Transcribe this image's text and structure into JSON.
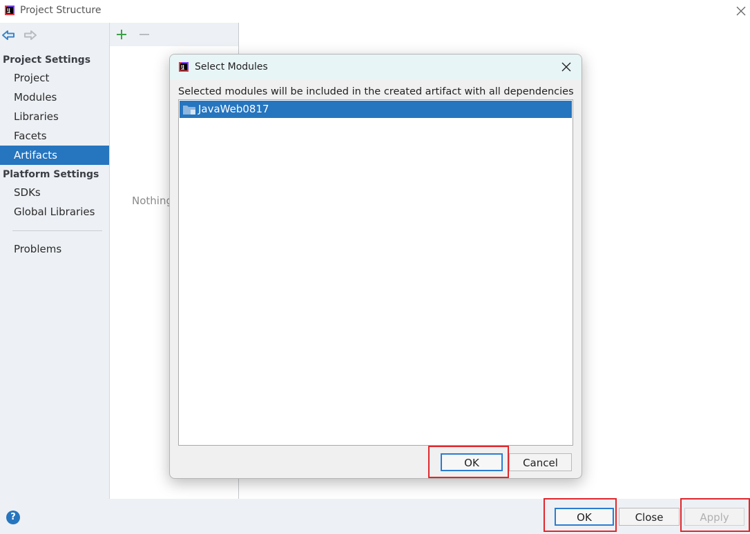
{
  "window": {
    "title": "Project Structure"
  },
  "sidebar": {
    "project_settings_header": "Project Settings",
    "platform_settings_header": "Platform Settings",
    "items": [
      "Project",
      "Modules",
      "Libraries",
      "Facets",
      "Artifacts",
      "SDKs",
      "Global Libraries",
      "Problems"
    ],
    "selected": "Artifacts"
  },
  "middle": {
    "empty_text": "Nothing"
  },
  "dialog": {
    "title": "Select Modules",
    "description": "Selected modules will be included in the created artifact with all dependencies",
    "modules": [
      "JavaWeb0817"
    ],
    "ok_label": "OK",
    "cancel_label": "Cancel"
  },
  "footer": {
    "help_label": "?",
    "ok_label": "OK",
    "close_label": "Close",
    "apply_label": "Apply"
  },
  "colors": {
    "selection": "#2675bf",
    "highlight": "#e0262b",
    "add_icon": "#3aa346"
  }
}
